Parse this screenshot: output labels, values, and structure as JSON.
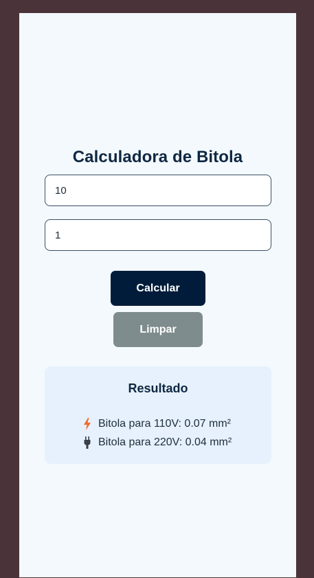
{
  "app": {
    "title": "Calculadora de Bitola"
  },
  "inputs": {
    "first_value": "10",
    "second_value": "1"
  },
  "buttons": {
    "calculate_label": "Calcular",
    "clear_label": "Limpar"
  },
  "result": {
    "title": "Resultado",
    "line_110_text": "Bitola para 110V: 0.07 mm²",
    "line_220_text": "Bitola para 220V: 0.04 mm²",
    "icons": [
      "lightning-icon",
      "plug-icon"
    ]
  },
  "colors": {
    "page_background": "#4a3439",
    "card_background": "#f3f9fd",
    "primary_dark": "#011c3b",
    "secondary_gray": "#7f8c8d",
    "result_background": "#e6f1fd",
    "lightning_orange": "#f26b2a"
  }
}
